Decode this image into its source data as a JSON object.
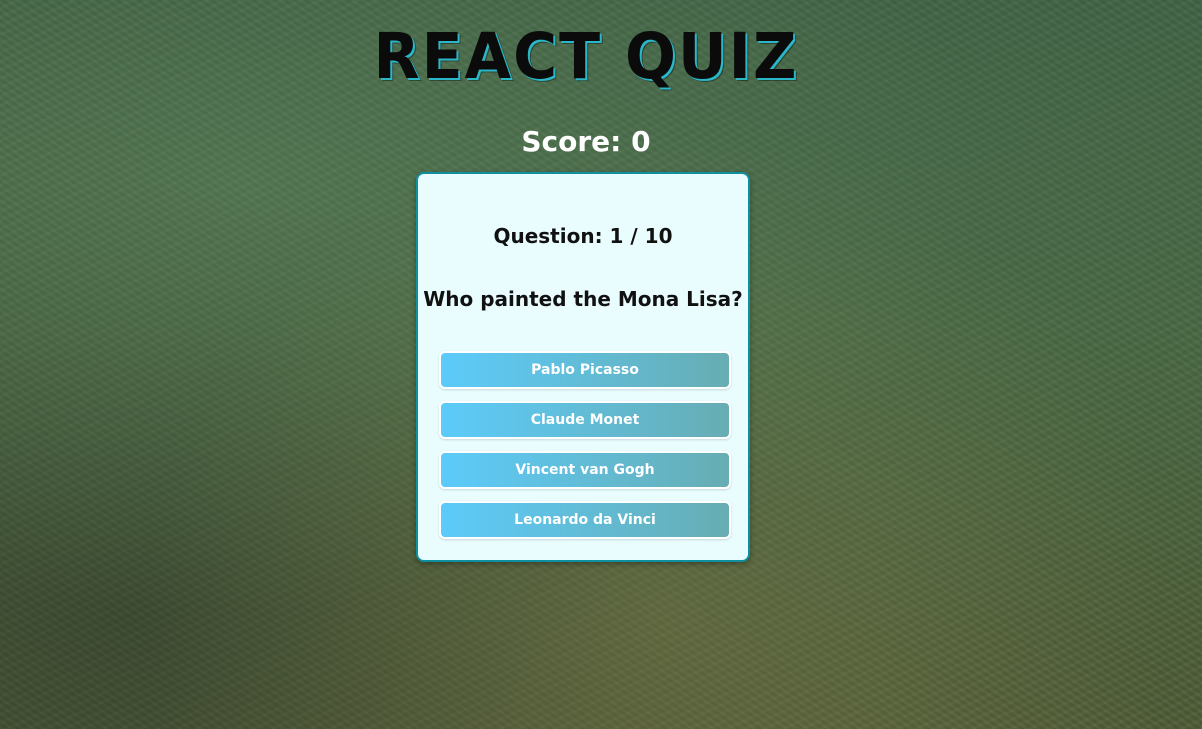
{
  "app": {
    "title": "REACT QUIZ"
  },
  "score": {
    "text": "Score: 0"
  },
  "quiz": {
    "question_number": "Question: 1 / 10",
    "question": "Who painted the Mona Lisa?",
    "answers": [
      "Pablo Picasso",
      "Claude Monet",
      "Vincent van Gogh",
      "Leonardo da Vinci"
    ]
  },
  "colors": {
    "title_text": "#0b0b0b",
    "title_shadow": "#2ab7c9",
    "card_background": "#e9fdfe",
    "card_border": "#0f8fa0",
    "button_gradient_start": "#5ccbfa",
    "button_gradient_end": "#67adb3"
  }
}
